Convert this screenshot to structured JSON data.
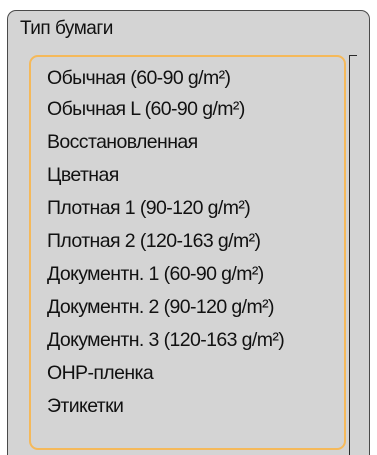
{
  "panel": {
    "title": "Тип бумаги",
    "items": [
      {
        "label": "Обычная (60-90 g/m²)"
      },
      {
        "label": "Обычная L (60-90 g/m²)"
      },
      {
        "label": "Восстановленная"
      },
      {
        "label": "Цветная"
      },
      {
        "label": "Плотная 1 (90-120 g/m²)"
      },
      {
        "label": "Плотная 2 (120-163 g/m²)"
      },
      {
        "label": "Документн. 1 (60-90 g/m²)"
      },
      {
        "label": "Документн. 2 (90-120 g/m²)"
      },
      {
        "label": "Документн. 3 (120-163 g/m²)"
      },
      {
        "label": "OHP-пленка"
      },
      {
        "label": "Этикетки"
      }
    ]
  },
  "colors": {
    "panel_background": "#d4d4d4",
    "focus_border": "#f5b95a",
    "text": "#111111"
  }
}
